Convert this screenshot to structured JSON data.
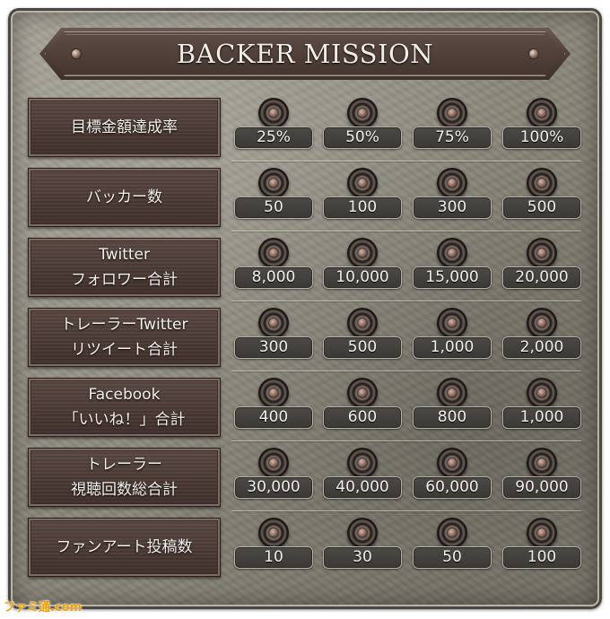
{
  "title": "BACKER MISSION",
  "missions": [
    {
      "label_lines": [
        "目標金額達成率"
      ],
      "values": [
        "25%",
        "50%",
        "75%",
        "100%"
      ]
    },
    {
      "label_lines": [
        "バッカー数"
      ],
      "values": [
        "50",
        "100",
        "300",
        "500"
      ]
    },
    {
      "label_lines": [
        "Twitter",
        "フォロワー合計"
      ],
      "values": [
        "8,000",
        "10,000",
        "15,000",
        "20,000"
      ]
    },
    {
      "label_lines": [
        "トレーラーTwitter",
        "リツイート合計"
      ],
      "values": [
        "300",
        "500",
        "1,000",
        "2,000"
      ]
    },
    {
      "label_lines": [
        "Facebook",
        "「いいね！」合計"
      ],
      "values": [
        "400",
        "600",
        "800",
        "1,000"
      ]
    },
    {
      "label_lines": [
        "トレーラー",
        "視聴回数総合計"
      ],
      "values": [
        "30,000",
        "40,000",
        "60,000",
        "90,000"
      ]
    },
    {
      "label_lines": [
        "ファンアート投稿数"
      ],
      "values": [
        "10",
        "30",
        "50",
        "100"
      ]
    }
  ],
  "watermark": "ファミ通.com",
  "icons": {
    "medal": "medal-icon",
    "rivet": "rivet-icon"
  },
  "colors": {
    "label_bg": "#4a3934",
    "value_bg": "#3a3835",
    "stone": "#8a877a",
    "text": "#f3f0ea"
  }
}
